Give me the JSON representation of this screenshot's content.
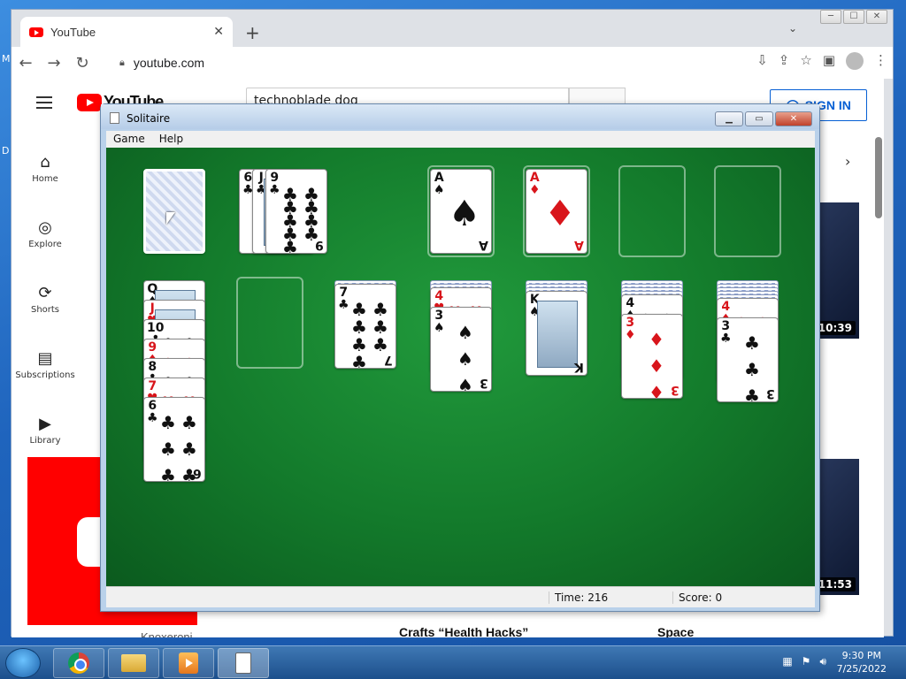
{
  "desktop": {
    "edge_text_1": "M",
    "edge_text_2": "D"
  },
  "browser": {
    "tab_title": "YouTube",
    "tab_close": "✕",
    "new_tab": "+",
    "url": "youtube.com",
    "win_min": "─",
    "win_max": "☐",
    "win_close": "✕"
  },
  "youtube": {
    "logo_text": "YouTube",
    "search_value": "technoblade dog",
    "signin_label": "SIGN IN",
    "sidebar": [
      {
        "label": "Home",
        "icon": "home-icon"
      },
      {
        "label": "Explore",
        "icon": "compass-icon"
      },
      {
        "label": "Shorts",
        "icon": "shorts-icon"
      },
      {
        "label": "Subscriptions",
        "icon": "subscriptions-icon"
      },
      {
        "label": "Library",
        "icon": "library-icon"
      }
    ],
    "durations": [
      "10:39",
      "11:53"
    ],
    "captions": [
      "Knoxeroni",
      "Crafts “Health Hacks”",
      "Space"
    ]
  },
  "solitaire": {
    "title": "Solitaire",
    "menu": [
      "Game",
      "Help"
    ],
    "time_label": "Time:",
    "time_value": "216",
    "score_label": "Score:",
    "score_value": "0",
    "stock": "face-down",
    "waste": [
      {
        "rank": "6",
        "suit": "♣",
        "color": "black"
      },
      {
        "rank": "J",
        "suit": "♣",
        "color": "black"
      },
      {
        "rank": "9",
        "suit": "♣",
        "color": "black"
      }
    ],
    "foundations": [
      {
        "rank": "A",
        "suit": "♠",
        "color": "black"
      },
      {
        "rank": "A",
        "suit": "♦",
        "color": "red"
      },
      null,
      null
    ],
    "tableau": [
      {
        "hidden": 0,
        "cards": [
          {
            "rank": "Q",
            "suit": "♠",
            "color": "black"
          },
          {
            "rank": "J",
            "suit": "♥",
            "color": "red"
          },
          {
            "rank": "10",
            "suit": "♣",
            "color": "black"
          },
          {
            "rank": "9",
            "suit": "♦",
            "color": "red"
          },
          {
            "rank": "8",
            "suit": "♣",
            "color": "black"
          },
          {
            "rank": "7",
            "suit": "♥",
            "color": "red"
          },
          {
            "rank": "6",
            "suit": "♣",
            "color": "black"
          }
        ]
      },
      {
        "hidden": 0,
        "cards": []
      },
      {
        "hidden": 1,
        "cards": [
          {
            "rank": "7",
            "suit": "♣",
            "color": "black"
          }
        ]
      },
      {
        "hidden": 2,
        "cards": [
          {
            "rank": "4",
            "suit": "♥",
            "color": "red"
          },
          {
            "rank": "3",
            "suit": "♠",
            "color": "black"
          }
        ]
      },
      {
        "hidden": 3,
        "cards": [
          {
            "rank": "K",
            "suit": "♠",
            "color": "black"
          }
        ]
      },
      {
        "hidden": 4,
        "cards": [
          {
            "rank": "4",
            "suit": "♠",
            "color": "black"
          },
          {
            "rank": "3",
            "suit": "♦",
            "color": "red"
          }
        ]
      },
      {
        "hidden": 5,
        "cards": [
          {
            "rank": "4",
            "suit": "♦",
            "color": "red"
          },
          {
            "rank": "3",
            "suit": "♣",
            "color": "black"
          }
        ]
      }
    ]
  },
  "taskbar": {
    "time": "9:30 PM",
    "date": "7/25/2022"
  }
}
